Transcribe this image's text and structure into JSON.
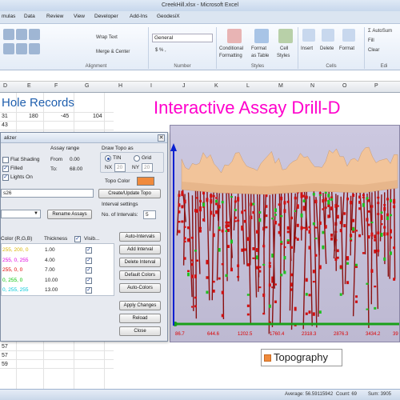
{
  "window": {
    "title": "CreekHill.xlsx - Microsoft Excel"
  },
  "tabs": [
    "mulas",
    "Data",
    "Review",
    "View",
    "Developer",
    "Add-Ins",
    "GeodesiX"
  ],
  "ribbon": {
    "wrap_text": "Wrap Text",
    "merge_center": "Merge & Center",
    "number_format": "General",
    "number_symbols": "$  %  ,",
    "cond_format": "Conditional",
    "cond_format2": "Formatting",
    "format_table": "Format",
    "format_table2": "as Table",
    "cell_styles": "Cell",
    "cell_styles2": "Styles",
    "insert": "Insert",
    "delete": "Delete",
    "format": "Format",
    "autosum": "AutoSum",
    "fill": "Fill",
    "clear": "Clear",
    "groups": {
      "alignment": "Alignment",
      "number": "Number",
      "styles": "Styles",
      "cells": "Cells",
      "editing": "Edi"
    }
  },
  "columns": [
    "D",
    "E",
    "F",
    "G",
    "H",
    "I",
    "J",
    "K",
    "L",
    "M",
    "N",
    "O",
    "P"
  ],
  "sheet": {
    "heading": "Hole Records",
    "row1": [
      "31",
      "180",
      "-45",
      "104"
    ],
    "row2": "43",
    "bottom_rows": [
      "57",
      "57",
      "59"
    ]
  },
  "dialog": {
    "title": "alizer",
    "flat_shading": "Flat Shading",
    "filled": "Filled",
    "lights_on": "Lights On",
    "assay_range": "Assay range",
    "from_label": "From",
    "from_value": "0.00",
    "to_label": "To:",
    "to_value": "68.00",
    "draw_topo_as": "Draw Topo as",
    "tin": "TIN",
    "grid": "Grid",
    "nx_label": "NX",
    "nx_value": "20",
    "ny_label": "NY",
    "ny_value": "20",
    "topo_color": "Topo Color",
    "name_value": "s26",
    "create_topo": "Create/Update Topo",
    "interval_settings": "Interval settings",
    "num_intervals_label": "No. of Intervals:",
    "num_intervals_value": "5",
    "rename_assays": "Rename Assays",
    "table_headers": {
      "color": "Color (R,G,B)",
      "thickness": "Thickness",
      "visible": "Visib..."
    },
    "rows": [
      {
        "color": "255, 200, 0",
        "thickness": "1.00",
        "color_hex": "#d9b400"
      },
      {
        "color": "255, 0, 255",
        "thickness": "4.00",
        "color_hex": "#e000e0"
      },
      {
        "color": "255, 0, 0",
        "thickness": "7.00",
        "color_hex": "#e00000"
      },
      {
        "color": "0, 255, 0",
        "thickness": "10.00",
        "color_hex": "#00c000"
      },
      {
        "color": "0, 255, 255",
        "thickness": "13.00",
        "color_hex": "#00c8d8"
      }
    ],
    "buttons": {
      "auto_intervals": "Auto-Intervals",
      "add_interval": "Add Interval",
      "delete_interval": "Delete Interval",
      "default_colors": "Default Colors",
      "auto_colors": "Auto-Colors",
      "apply_changes": "Apply Changes",
      "reload": "Reload",
      "close": "Close"
    }
  },
  "chart": {
    "title": "Interactive Assay Drill-D",
    "x_ticks": [
      "86.7",
      "644.6",
      "1202.5",
      "1760.4",
      "2318.3",
      "2876.3",
      "3434.2",
      "39"
    ],
    "legend": "Topography",
    "topo_color": "#f2c49a"
  },
  "status": {
    "average": "Average: 56.59115942",
    "count": "Count: 69",
    "sum": "Sum: 3905"
  }
}
